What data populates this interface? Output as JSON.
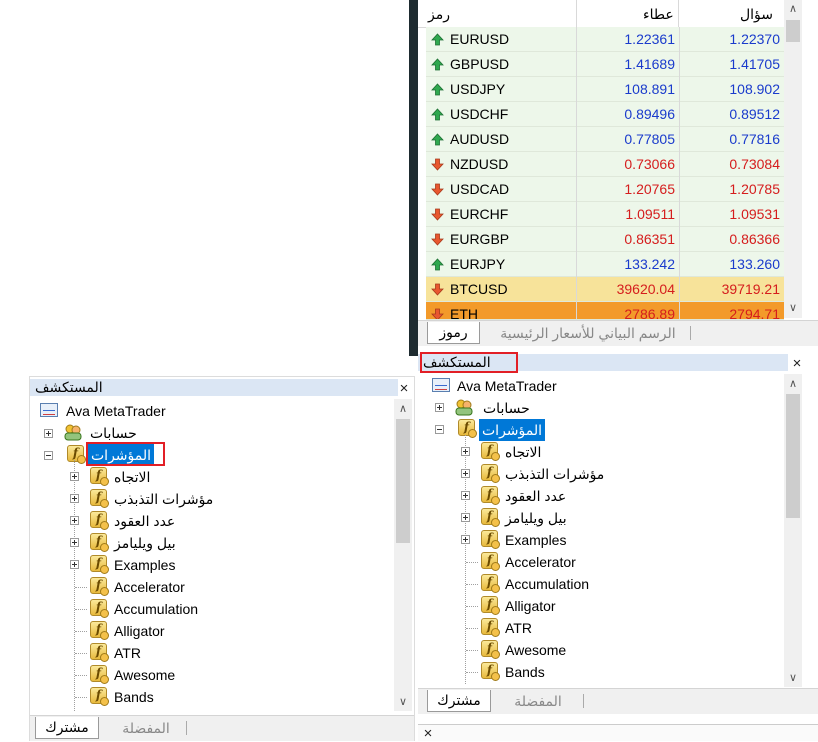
{
  "market_watch": {
    "headers": {
      "symbol": "رمز",
      "bid": "عطاء",
      "ask": "سؤال"
    },
    "rows": [
      {
        "symbol": "EURUSD",
        "bid": "1.22361",
        "ask": "1.22370",
        "dir": "up"
      },
      {
        "symbol": "GBPUSD",
        "bid": "1.41689",
        "ask": "1.41705",
        "dir": "up"
      },
      {
        "symbol": "USDJPY",
        "bid": "108.891",
        "ask": "108.902",
        "dir": "up"
      },
      {
        "symbol": "USDCHF",
        "bid": "0.89496",
        "ask": "0.89512",
        "dir": "up"
      },
      {
        "symbol": "AUDUSD",
        "bid": "0.77805",
        "ask": "0.77816",
        "dir": "up"
      },
      {
        "symbol": "NZDUSD",
        "bid": "0.73066",
        "ask": "0.73084",
        "dir": "down"
      },
      {
        "symbol": "USDCAD",
        "bid": "1.20765",
        "ask": "1.20785",
        "dir": "down"
      },
      {
        "symbol": "EURCHF",
        "bid": "1.09511",
        "ask": "1.09531",
        "dir": "down"
      },
      {
        "symbol": "EURGBP",
        "bid": "0.86351",
        "ask": "0.86366",
        "dir": "down"
      },
      {
        "symbol": "EURJPY",
        "bid": "133.242",
        "ask": "133.260",
        "dir": "up"
      },
      {
        "symbol": "BTCUSD",
        "bid": "39620.04",
        "ask": "39719.21",
        "dir": "down"
      },
      {
        "symbol": "ETH",
        "bid": "2786.89",
        "ask": "2794.71",
        "dir": "down"
      }
    ],
    "tabs": {
      "symbols": "رموز",
      "chart": "الرسم البياني للأسعار الرئيسية"
    }
  },
  "navigator_right": {
    "title": "المستكشف",
    "close": "×",
    "root": "Ava MetaTrader",
    "accounts": "حسابات",
    "indicators": "المؤشرات",
    "folders": [
      "الاتجاه",
      "مؤشرات التذبذب",
      "عدد العقود",
      "بيل ويليامز",
      "Examples"
    ],
    "items": [
      "Accelerator",
      "Accumulation",
      "Alligator",
      "ATR",
      "Awesome",
      "Bands"
    ],
    "tabs": {
      "common": "مشترك",
      "favorites": "المفضلة"
    }
  },
  "navigator_left": {
    "title": "المستكشف",
    "close": "×",
    "root": "Ava MetaTrader",
    "accounts": "حسابات",
    "indicators": "المؤشرات",
    "folders": [
      "الاتجاه",
      "مؤشرات التذبذب",
      "عدد العقود",
      "بيل ويليامز",
      "Examples"
    ],
    "items": [
      "Accelerator",
      "Accumulation",
      "Alligator",
      "ATR",
      "Awesome",
      "Bands"
    ],
    "tabs": {
      "common": "مشترك",
      "favorites": "المفضلة"
    }
  },
  "bottom_panel": {
    "close": "×"
  },
  "colors": {
    "up": "#1a3bcc",
    "down": "#d51d1d",
    "btc_row": "#f7e39a",
    "eth_row": "#f39a2a",
    "selection": "#0078d7",
    "highlight_box": "#e21f26"
  }
}
